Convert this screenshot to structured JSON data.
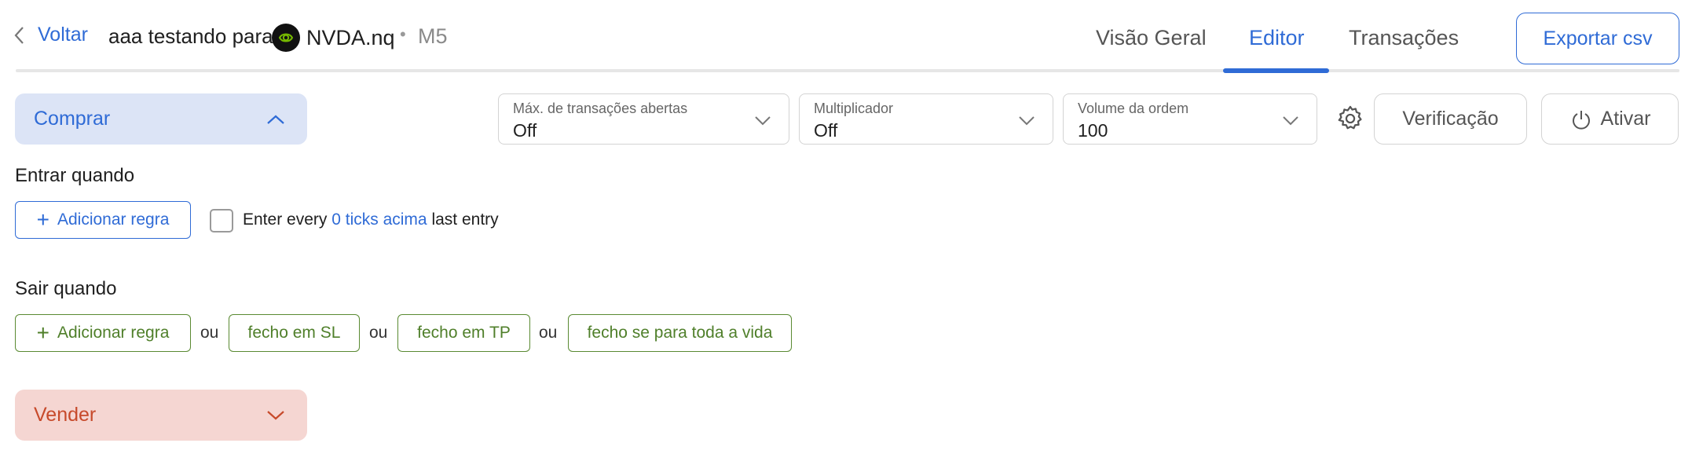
{
  "header": {
    "back_label": "Voltar",
    "strategy_title": "aaa testando para",
    "symbol": "NVDA.nq",
    "separator": "•",
    "timeframe": "M5",
    "tabs": [
      {
        "label": "Visão Geral",
        "active": false
      },
      {
        "label": "Editor",
        "active": true
      },
      {
        "label": "Transações",
        "active": false
      }
    ],
    "export_label": "Exportar csv"
  },
  "buy": {
    "label": "Comprar",
    "expanded": true
  },
  "controls": {
    "max_open": {
      "label": "Máx. de transações abertas",
      "value": "Off"
    },
    "multiplier": {
      "label": "Multiplicador",
      "value": "Off"
    },
    "order_volume": {
      "label": "Volume da ordem",
      "value": "100"
    },
    "verify_label": "Verificação",
    "activate_label": "Ativar"
  },
  "enter": {
    "heading": "Entrar quando",
    "add_rule": "Adicionar regra",
    "every_prefix": "Enter every",
    "every_link": "0 ticks acima",
    "every_suffix": "last entry",
    "checked": false
  },
  "exit": {
    "heading": "Sair quando",
    "add_rule": "Adicionar regra",
    "or": "ou",
    "rules": [
      "fecho em SL",
      "fecho em TP",
      "fecho se para toda a vida"
    ]
  },
  "sell": {
    "label": "Vender",
    "expanded": false
  },
  "colors": {
    "accent": "#2f6bd6",
    "buy_bg": "#dce4f6",
    "sell_bg": "#f5d6d2",
    "sell_text": "#c74a2b",
    "exit_green": "#4f7f2a"
  }
}
